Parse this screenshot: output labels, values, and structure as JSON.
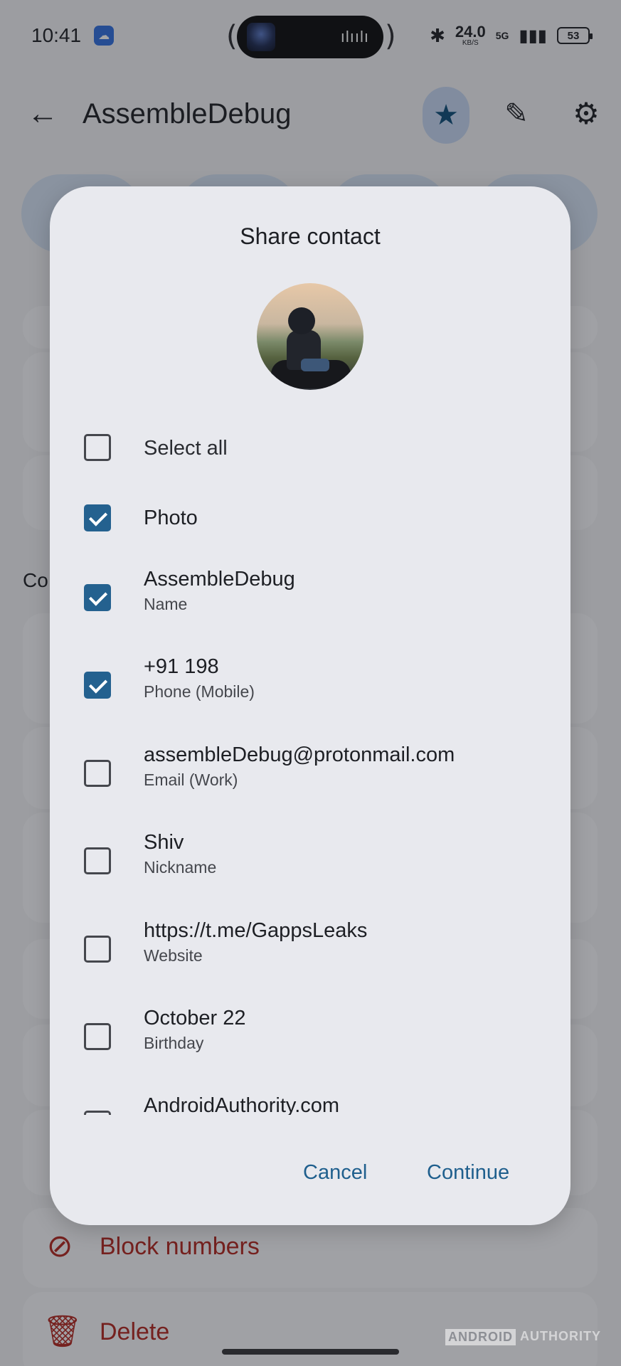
{
  "status_bar": {
    "time": "10:41",
    "net_speed": "24.0",
    "net_unit": "KB/S",
    "network": "5G",
    "battery": "53"
  },
  "app_bar": {
    "title": "AssembleDebug"
  },
  "background": {
    "section_label": "Co",
    "actions": [
      {
        "label": "Block numbers",
        "icon": "block-icon"
      },
      {
        "label": "Delete",
        "icon": "trash-icon"
      }
    ]
  },
  "dialog": {
    "title": "Share contact",
    "options": [
      {
        "primary": "Select all",
        "secondary": "",
        "checked": false
      },
      {
        "primary": "Photo",
        "secondary": "",
        "checked": true
      },
      {
        "primary": "AssembleDebug",
        "secondary": "Name",
        "checked": true
      },
      {
        "primary": "+91 198",
        "secondary": "Phone (Mobile)",
        "checked": true
      },
      {
        "primary": "assembleDebug@protonmail.com",
        "secondary": "Email (Work)",
        "checked": false
      },
      {
        "primary": "Shiv",
        "secondary": "Nickname",
        "checked": false
      },
      {
        "primary": "https://t.me/GappsLeaks",
        "secondary": "Website",
        "checked": false
      },
      {
        "primary": "October 22",
        "secondary": "Birthday",
        "checked": false
      },
      {
        "primary": "AndroidAuthority.com",
        "secondary": "",
        "checked": false
      }
    ],
    "cancel_label": "Cancel",
    "continue_label": "Continue"
  },
  "watermark": {
    "left": "ANDROID",
    "right": "AUTHORITY"
  },
  "colors": {
    "accent": "#24618f",
    "button_text": "#1f5f8d",
    "destructive": "#b3261e",
    "dialog_bg": "#e8e9ee"
  }
}
